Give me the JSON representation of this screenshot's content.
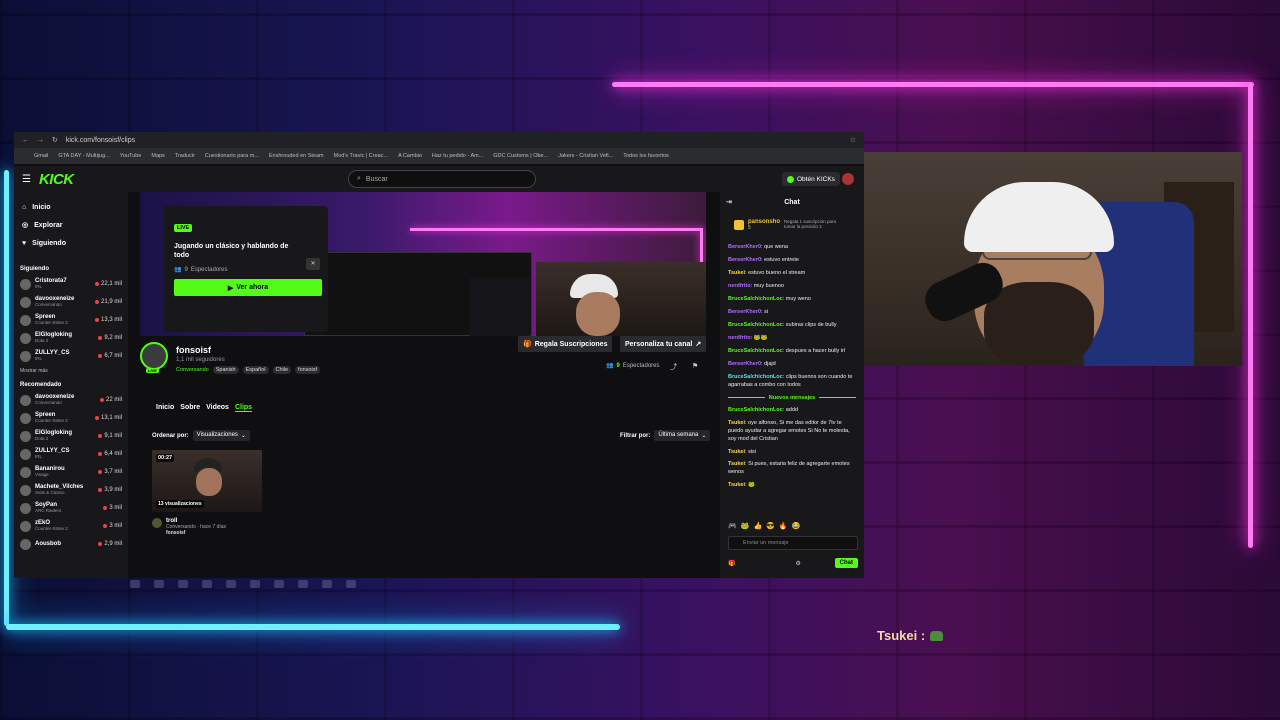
{
  "browser": {
    "url": "kick.com/fonsoisf/clips",
    "bookmarks": [
      "Gmail",
      "GTA DAY - Multijug...",
      "YouTube",
      "Maps",
      "Traducir",
      "Cuestionario para m...",
      "Enshrouded en Steam",
      "Mod's Travic | Creac...",
      "A Cambio",
      "Haz tu pedido - Am...",
      "GDC Customs | Obe...",
      "Jakers - Cristian Vefi...",
      "Todos los favoritos"
    ]
  },
  "kick": {
    "logo": "KICK",
    "search_placeholder": "Buscar",
    "kicks_label": "Obtén KICKs",
    "nav": [
      {
        "label": "Inicio",
        "icon": "home-icon"
      },
      {
        "label": "Explorar",
        "icon": "compass-icon"
      },
      {
        "label": "Siguiendo",
        "icon": "heart-icon"
      }
    ],
    "following_title": "Siguiendo",
    "following": [
      {
        "name": "Cristorata7",
        "category": "IRL",
        "viewers": "22,1 mil"
      },
      {
        "name": "davooxeneize",
        "category": "Conversando",
        "viewers": "21,9 mil"
      },
      {
        "name": "Spreen",
        "category": "Counter-Strike 2",
        "viewers": "13,3 mil"
      },
      {
        "name": "ElGlogloking",
        "category": "Dota 2",
        "viewers": "9,2 mil"
      },
      {
        "name": "ZULLYY_CS",
        "category": "IRL",
        "viewers": "6,7 mil"
      }
    ],
    "show_more": "Mostrar más",
    "recommended_title": "Recomendado",
    "recommended": [
      {
        "name": "davooxeneize",
        "category": "Conversando",
        "viewers": "22 mil"
      },
      {
        "name": "Spreen",
        "category": "Counter-Strike 2",
        "viewers": "13,1 mil"
      },
      {
        "name": "ElGlogloking",
        "category": "Dota 2",
        "viewers": "9,1 mil"
      },
      {
        "name": "ZULLYY_CS",
        "category": "IRL",
        "viewers": "6,4 mil"
      },
      {
        "name": "Bananirou",
        "category": "Visage",
        "viewers": "3,7 mil"
      },
      {
        "name": "Machete_Vilches",
        "category": "Slots & Casino",
        "viewers": "3,9 mil"
      },
      {
        "name": "SoyPan",
        "category": "ARC Raiders",
        "viewers": "3 mil"
      },
      {
        "name": "zEkO",
        "category": "Counter-Strike 2",
        "viewers": "3 mil"
      },
      {
        "name": "Aousbob",
        "category": "",
        "viewers": "2,9 mil"
      }
    ],
    "live_card": {
      "badge": "LIVE",
      "title": "Jugando un clásico y hablando de todo",
      "viewers": "9",
      "viewers_label": "Espectadores",
      "watch": "Ver ahora"
    },
    "channel": {
      "name": "fonsoisf",
      "followers": "1,1 mil seguidores",
      "category": "Conversando",
      "tags": [
        "Spanish",
        "Español",
        "Chile",
        "fonsoisf"
      ],
      "gift_label": "Regala Suscripciones",
      "personalize_label": "Personaliza tu canal",
      "viewers": "9",
      "viewers_label": "Espectadores",
      "live_mini": "LIVE"
    },
    "tabs": [
      "Inicio",
      "Sobre",
      "Videos",
      "Clips"
    ],
    "active_tab": "Clips",
    "sort_label": "Ordenar por:",
    "sort_value": "Visualizaciones",
    "filter_label": "Filtrar por:",
    "filter_value": "Última semana",
    "clip": {
      "duration": "00:27",
      "views": "13 visualizaciones",
      "title": "troll",
      "subtitle": "Conversando · hace 7 días",
      "author": "fonsoisf"
    },
    "chat": {
      "title": "Chat",
      "pinned_user": "pansonsho",
      "pinned_count": "5",
      "pinned_desc": "Regala 1 suscripción para tomar la posición 2",
      "messages": [
        {
          "user": "BerserKher0",
          "color": "p",
          "text": "que wena"
        },
        {
          "user": "BerserKher0",
          "color": "p",
          "text": "estuvo entrete"
        },
        {
          "user": "Tsukei",
          "color": "y",
          "text": "estuvo bueno el stream"
        },
        {
          "user": "nerdfrito",
          "color": "p",
          "text": "muy buenoo"
        },
        {
          "user": "BruceSalchichonLoc",
          "color": "g",
          "text": "muy weno"
        },
        {
          "user": "BerserKher0",
          "color": "p",
          "text": "si"
        },
        {
          "user": "BruceSalchichonLoc",
          "color": "g",
          "text": "subiras clips de bully"
        },
        {
          "user": "nerdfrito",
          "color": "p",
          "text": "🐸🐸"
        },
        {
          "user": "BruceSalchichonLoc",
          "color": "g",
          "text": "despues a hacer bully irl"
        },
        {
          "user": "BerserKher0",
          "color": "p",
          "text": "djajd"
        },
        {
          "user": "BruceSalchichonLoc",
          "color": "b",
          "text": "clips buenos son cuando te agarrabas a combo con todos"
        }
      ],
      "new_messages": "Nuevos mensajes",
      "messages_after": [
        {
          "user": "BruceSalchichonLoc",
          "color": "g",
          "text": "addd"
        },
        {
          "user": "Tsukei",
          "color": "y",
          "text": "oye alfonso, Si me das editor de 7tv te puedo ayudar a agregar emotes Si No te molesta, soy mod del Cristian"
        },
        {
          "user": "Tsukei",
          "color": "y",
          "text": "sisi"
        },
        {
          "user": "Tsukei",
          "color": "y",
          "text": "Si pues, estaria feliz de agregarte emotes wenos"
        },
        {
          "user": "Tsukei",
          "color": "y",
          "text": "🐸"
        }
      ],
      "input_placeholder": "Enviar un mensaje",
      "send": "Chat"
    }
  },
  "overlay": {
    "user": "Tsukei :",
    "emote": "frog-emote"
  },
  "colors": {
    "kick_green": "#53fc18",
    "neon_pink": "#ff7bf5",
    "neon_blue": "#6ff0ff"
  }
}
